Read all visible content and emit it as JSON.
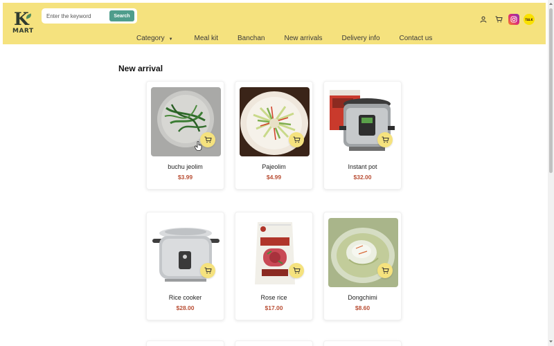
{
  "header": {
    "logo": {
      "letter": "K",
      "word": "MART"
    },
    "search": {
      "placeholder": "Enter the keyword",
      "button_label": "Search"
    },
    "icons": [
      "user-icon",
      "cart-icon",
      "instagram-icon",
      "kakaotalk-icon"
    ],
    "kakao_label": "TALK",
    "nav": [
      {
        "label": "Category",
        "has_dropdown": true
      },
      {
        "label": "Meal kit"
      },
      {
        "label": "Banchan"
      },
      {
        "label": "New arrivals"
      },
      {
        "label": "Delivery info"
      },
      {
        "label": "Contact us"
      }
    ]
  },
  "main": {
    "section_title": "New arrival",
    "products": [
      {
        "name": "buchu jeolim",
        "price": "$3.99"
      },
      {
        "name": "Pajeolim",
        "price": "$4.99"
      },
      {
        "name": "Instant pot",
        "price": "$32.00"
      },
      {
        "name": "Rice cooker",
        "price": "$28.00"
      },
      {
        "name": "Rose rice",
        "price": "$17.00"
      },
      {
        "name": "Dongchimi",
        "price": "$8.60"
      }
    ]
  },
  "colors": {
    "header_bg": "#f5e27e",
    "search_button": "#4f9d8c",
    "price": "#b94e34",
    "cart_fab": "#f5e27e"
  }
}
